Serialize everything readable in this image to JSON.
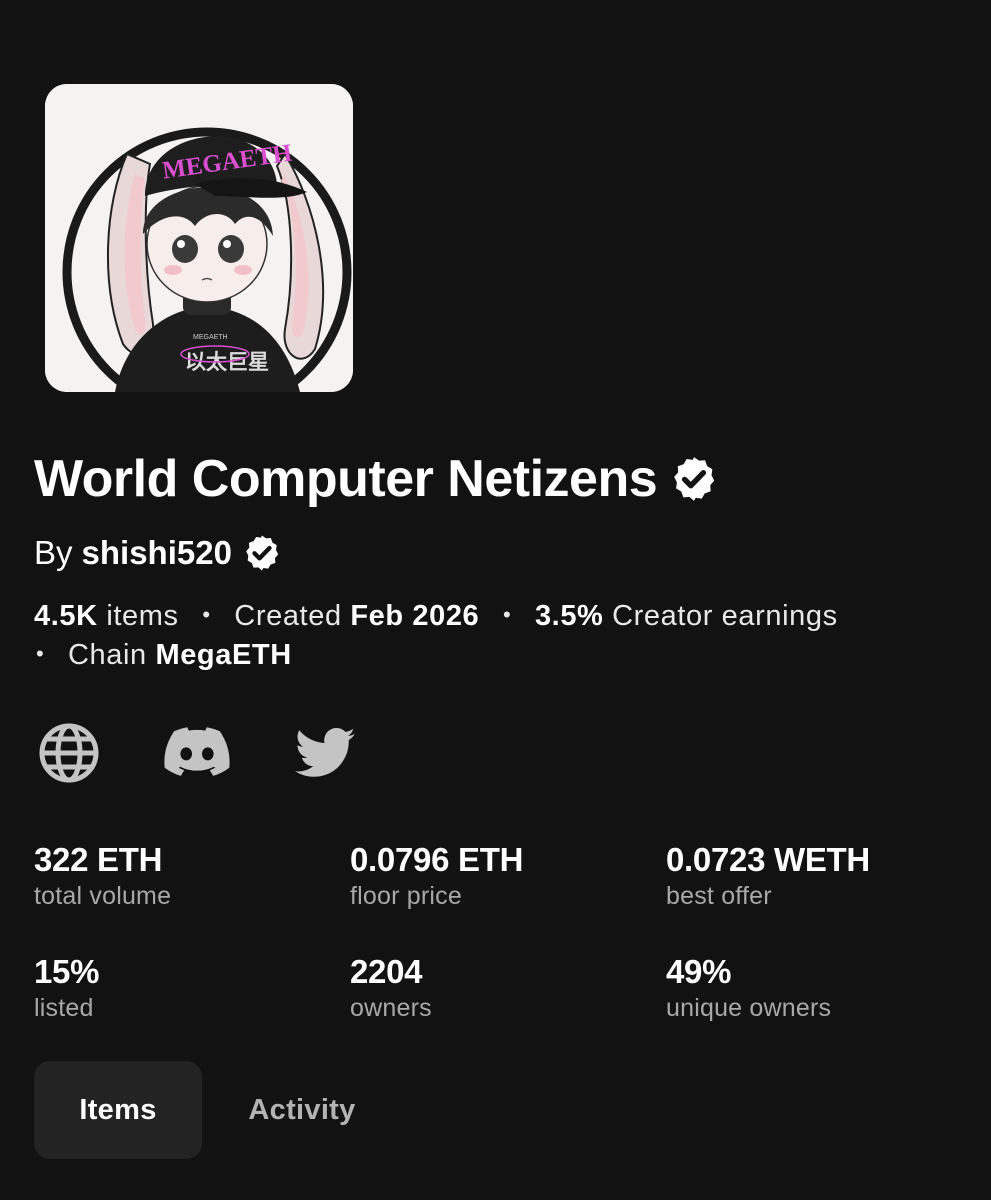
{
  "collection": {
    "title": "World Computer Netizens",
    "by_label": "By",
    "creator": "shishi520",
    "avatar_text": {
      "cap": "MEGAETH",
      "shirt_top": "MEGAETH",
      "shirt_main": "以太巨星"
    }
  },
  "meta": {
    "items_value": "4.5K",
    "items_label": "items",
    "created_label": "Created",
    "created_value": "Feb 2026",
    "earnings_value": "3.5%",
    "earnings_label": "Creator earnings",
    "chain_label": "Chain",
    "chain_value": "MegaETH",
    "separator": "•"
  },
  "socials": [
    "globe-icon",
    "discord-icon",
    "twitter-icon"
  ],
  "stats": [
    {
      "value": "322 ETH",
      "label": "total volume"
    },
    {
      "value": "0.0796 ETH",
      "label": "floor price"
    },
    {
      "value": "0.0723 WETH",
      "label": "best offer"
    },
    {
      "value": "15%",
      "label": "listed"
    },
    {
      "value": "2204",
      "label": "owners"
    },
    {
      "value": "49%",
      "label": "unique owners"
    }
  ],
  "tabs": [
    {
      "label": "Items",
      "active": true
    },
    {
      "label": "Activity",
      "active": false
    }
  ],
  "colors": {
    "background": "#121212",
    "text": "#ffffff",
    "muted": "#a8a8a8",
    "icon": "#c4c4c4",
    "tab_active_bg": "#232323",
    "accent_pink": "#d94fd0"
  }
}
